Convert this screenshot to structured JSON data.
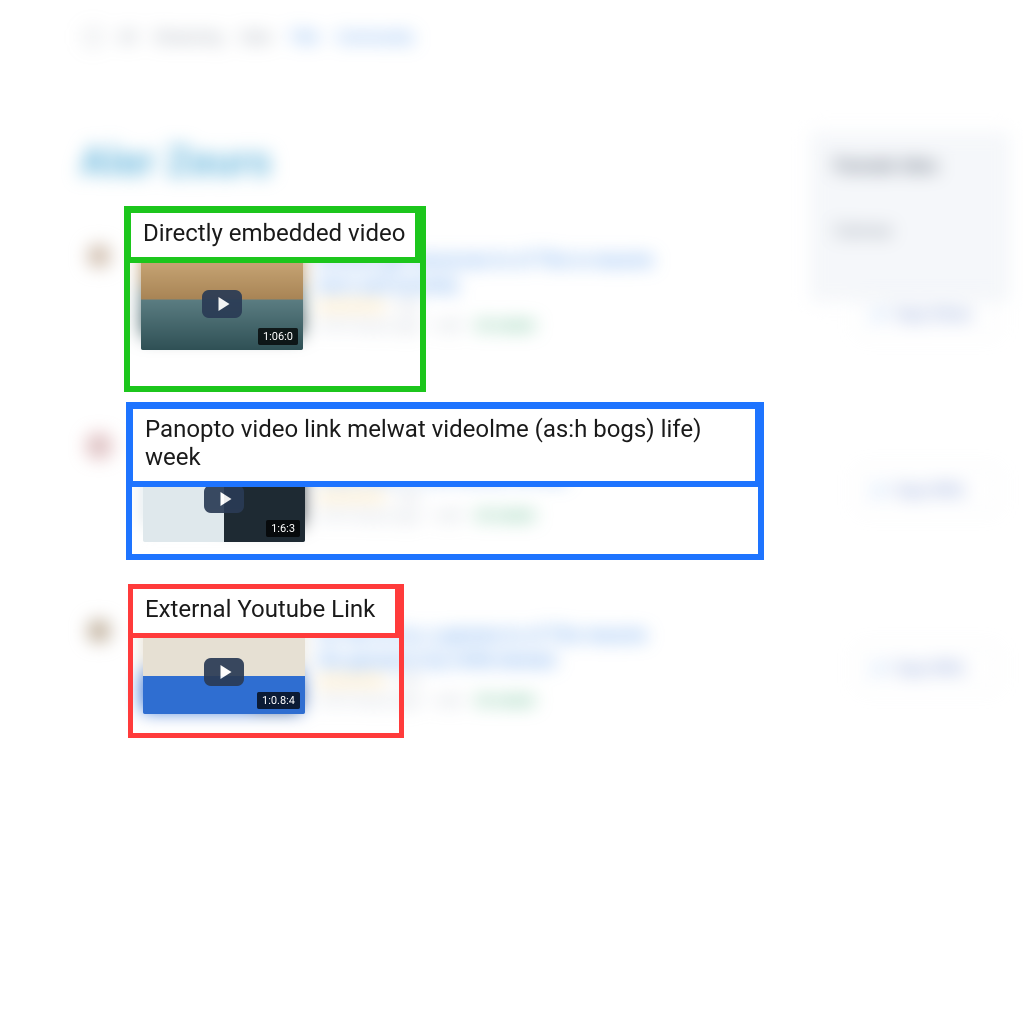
{
  "nav": {
    "items": [
      "All",
      "Streaming",
      "Date",
      "Title",
      "Community"
    ]
  },
  "page": {
    "title": "Aler Zeurs"
  },
  "results": [
    {
      "line1a": "browse get resources to of This is resume",
      "line1b": "term and tomistiy",
      "rating_count": "102",
      "meta_row2": "0.012 hours ago — well",
      "meta_tag": "26 trailed",
      "duration": "1:06:0"
    },
    {
      "line1a": "choose nigeniuin oglenics Agedeps",
      "line1b": "iness anal 1 is probably lewday.",
      "rating_count": "195",
      "meta_row2": "0.012 hours ago — well",
      "meta_tag": "26 trailed",
      "duration": "1:6:3"
    },
    {
      "line1a": "for the of1os, a genene to of This resume",
      "line1b": "the gessed is by chitle bereed.",
      "rating_count": "125",
      "meta_row2": "0.012 hours ago — well",
      "meta_tag": "26 trailed",
      "duration": "1:0.8:4"
    }
  ],
  "sidebar": {
    "heading": "Famale Ideo",
    "section": "Cannue",
    "pills": [
      "Sopy Srless",
      "Sopy Wlifo",
      "Sopy Wlifo"
    ]
  },
  "annotations": {
    "a1": "Directly embedded video",
    "a2": "Panopto video link melwat videolme (as:h bogs) life) week",
    "a3": "External Youtube Link"
  }
}
